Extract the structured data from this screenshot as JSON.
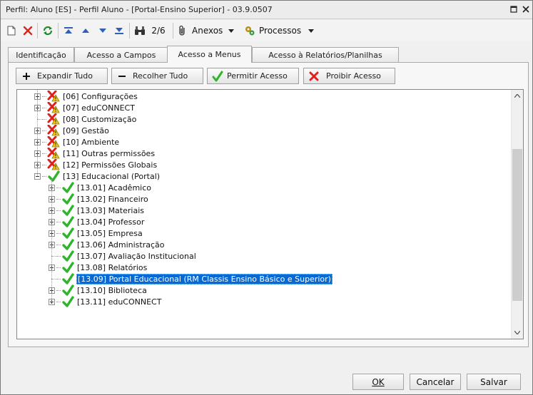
{
  "window": {
    "title": "Perfil: Aluno [ES] - Perfil Aluno - [Portal-Ensino Superior] - 03.9.0507"
  },
  "toolbar": {
    "record_position": "2/6",
    "attachments_label": "Anexos",
    "processes_label": "Processos"
  },
  "tabs": [
    {
      "label": "Identificação"
    },
    {
      "label": "Acesso a Campos"
    },
    {
      "label": "Acesso a Menus"
    },
    {
      "label": "Acesso à Relatórios/Planilhas"
    }
  ],
  "active_tab": "Acesso a Menus",
  "actions": {
    "expand_all": "Expandir Tudo",
    "collapse_all": "Recolher Tudo",
    "allow_access": "Permitir Acesso",
    "deny_access": "Proibir Acesso"
  },
  "tree": {
    "top_level": [
      {
        "label": "[06] Configurações",
        "status": "denied-warning",
        "expandable": true
      },
      {
        "label": "[07] eduCONNECT",
        "status": "denied-warning",
        "expandable": true
      },
      {
        "label": "[08] Customização",
        "status": "denied-warning",
        "expandable": false
      },
      {
        "label": "[09] Gestão",
        "status": "denied-warning",
        "expandable": true
      },
      {
        "label": "[10] Ambiente",
        "status": "denied-warning",
        "expandable": true
      },
      {
        "label": "[11] Outras permissões",
        "status": "denied-warning",
        "expandable": true
      },
      {
        "label": "[12] Permissões Globais",
        "status": "denied-warning",
        "expandable": true
      },
      {
        "label": "[13] Educacional (Portal)",
        "status": "allowed",
        "expandable": true,
        "expanded": true
      }
    ],
    "children": [
      {
        "label": "[13.01] Acadêmico",
        "status": "allowed",
        "expandable": true
      },
      {
        "label": "[13.02] Financeiro",
        "status": "allowed",
        "expandable": true
      },
      {
        "label": "[13.03] Materiais",
        "status": "allowed",
        "expandable": true
      },
      {
        "label": "[13.04] Professor",
        "status": "allowed",
        "expandable": true
      },
      {
        "label": "[13.05] Empresa",
        "status": "allowed",
        "expandable": true
      },
      {
        "label": "[13.06] Administração",
        "status": "allowed",
        "expandable": true
      },
      {
        "label": "[13.07] Avaliação Institucional",
        "status": "allowed",
        "expandable": false
      },
      {
        "label": "[13.08] Relatórios",
        "status": "allowed",
        "expandable": true
      },
      {
        "label": "[13.09] Portal Educacional (RM Classis Ensino Básico e Superior)",
        "status": "allowed",
        "expandable": false,
        "selected": true
      },
      {
        "label": "[13.10] Biblioteca",
        "status": "allowed",
        "expandable": true
      },
      {
        "label": "[13.11] eduCONNECT",
        "status": "allowed",
        "expandable": true
      }
    ]
  },
  "footer": {
    "ok": "OK",
    "cancel": "Cancelar",
    "save": "Salvar"
  },
  "colors": {
    "selection": "#0a69d1",
    "allowed": "#2fb52a",
    "denied": "#e02020",
    "warning": "#f5c400"
  }
}
